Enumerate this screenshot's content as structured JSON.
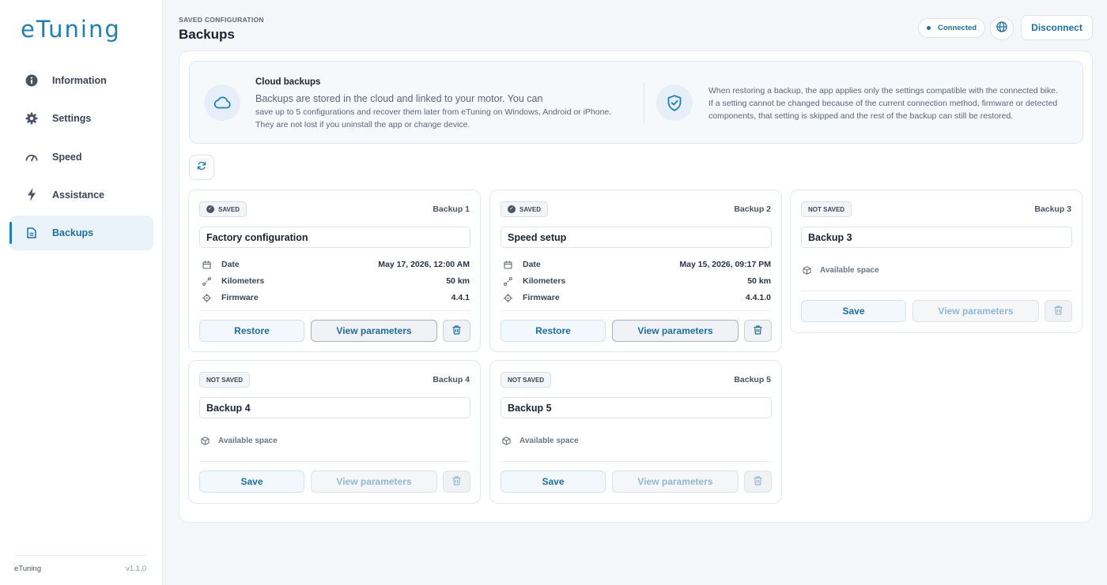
{
  "app": {
    "logo": "eTuning",
    "footer_name": "eTuning",
    "version": "v1.1.0",
    "accent_color": "#1f7fae"
  },
  "sidebar": {
    "items": [
      {
        "label": "Information",
        "icon": "info-icon",
        "active": false
      },
      {
        "label": "Settings",
        "icon": "gear-icon",
        "active": false
      },
      {
        "label": "Speed",
        "icon": "speedometer-icon",
        "active": false
      },
      {
        "label": "Assistance",
        "icon": "lightning-icon",
        "active": false
      },
      {
        "label": "Backups",
        "icon": "document-icon",
        "active": true
      }
    ]
  },
  "header": {
    "subtitle": "SAVED CONFIGURATION",
    "title": "Backups",
    "status": "Connected",
    "disconnect_label": "Disconnect"
  },
  "info": {
    "title": "Cloud backups",
    "line1": "Backups are stored in the cloud and linked to your motor. You can",
    "line2": "save up to 5 configurations and recover them later from eTuning on Windows, Android or iPhone.",
    "line3": "They are not lost if you uninstall the app or change device.",
    "restore_line1": "When restoring a backup, the app applies only the settings compatible with the connected bike.",
    "restore_line2": "If a setting cannot be changed because of the current connection method, firmware or detected",
    "restore_line3": "components, that setting is skipped and the rest of the backup can still be restored."
  },
  "labels": {
    "date": "Date",
    "kilometers": "Kilometers",
    "firmware": "Firmware",
    "available_space": "Available space",
    "restore": "Restore",
    "save": "Save",
    "view_parameters": "View parameters"
  },
  "backups": [
    {
      "status": "SAVED",
      "slot": "Backup 1",
      "name": "Factory configuration",
      "date": "May 17, 2026, 12:00 AM",
      "kilometers": "50 km",
      "firmware": "4.4.1"
    },
    {
      "status": "SAVED",
      "slot": "Backup 2",
      "name": "Speed setup",
      "date": "May 15, 2026, 09:17 PM",
      "kilometers": "50 km",
      "firmware": "4.4.1.0"
    },
    {
      "status": "NOT SAVED",
      "slot": "Backup 3",
      "name": "Backup 3"
    },
    {
      "status": "NOT SAVED",
      "slot": "Backup 4",
      "name": "Backup 4"
    },
    {
      "status": "NOT SAVED",
      "slot": "Backup 5",
      "name": "Backup 5"
    }
  ]
}
